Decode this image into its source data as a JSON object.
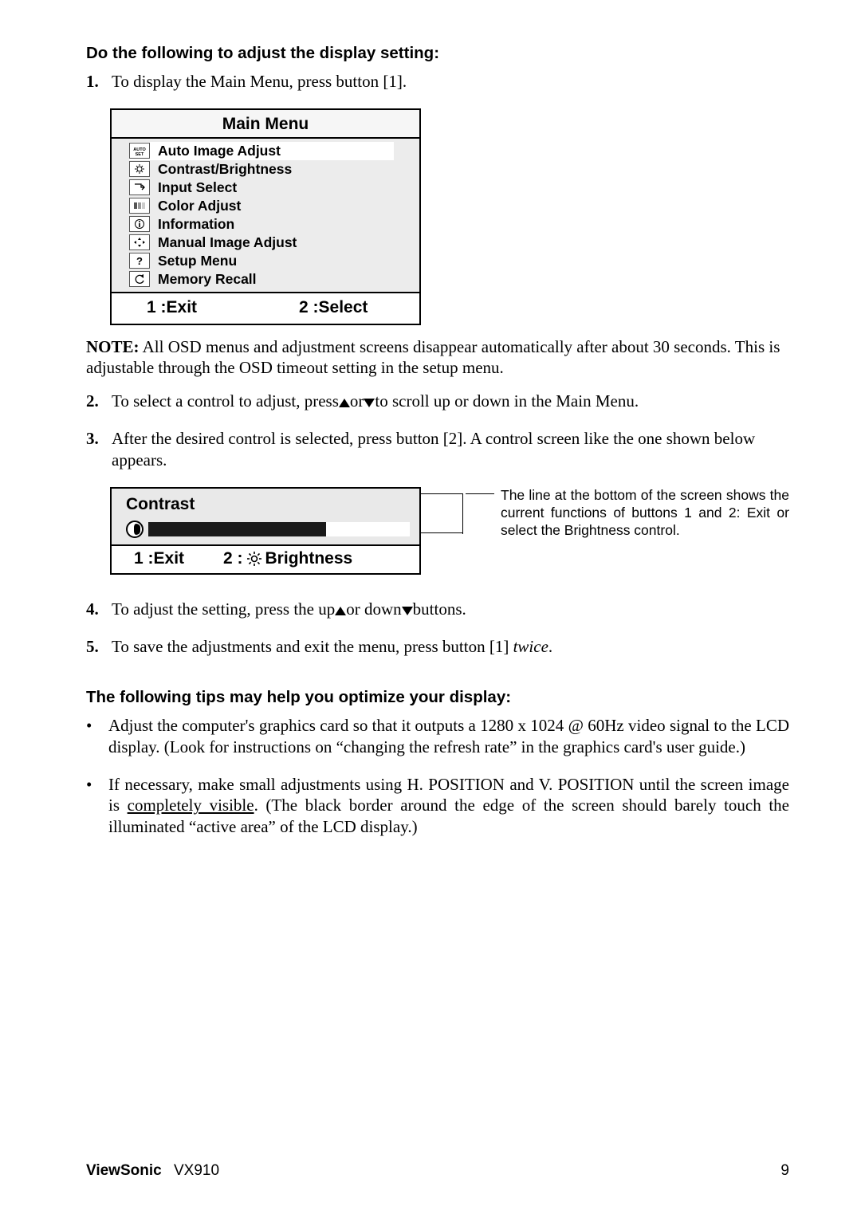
{
  "heading1": "Do the following to adjust the display setting:",
  "step1_num": "1.",
  "step1_text": "To display the Main Menu, press button [1].",
  "menu": {
    "title": "Main Menu",
    "items": [
      "Auto Image Adjust",
      "Contrast/Brightness",
      "Input Select",
      "Color Adjust",
      "Information",
      "Manual Image Adjust",
      "Setup Menu",
      "Memory Recall"
    ],
    "footer_left": "1 :Exit",
    "footer_right": "2 :Select"
  },
  "note_label": "NOTE:",
  "note_text": " All OSD menus and adjustment screens disappear automatically after about 30 seconds. This is adjustable through the OSD timeout setting in the setup menu.",
  "step2_num": "2.",
  "step2_a": "To select a control to adjust, press",
  "step2_b": "or",
  "step2_c": "to scroll up or down in the Main Menu.",
  "step3_num": "3.",
  "step3_text": "After the desired control is selected, press button [2]. A control screen like the one shown below appears.",
  "contrast": {
    "title": "Contrast",
    "left": "1 :Exit",
    "right_pre": "2 :",
    "right_post": " Brightness"
  },
  "callout": "The line at the bottom of the screen shows the current functions of buttons 1 and 2: Exit or select the Brightness control.",
  "step4_num": "4.",
  "step4_a": "To adjust the setting, press the up",
  "step4_b": "or down",
  "step4_c": "buttons.",
  "step5_num": "5.",
  "step5_a": "To save the adjustments and exit the menu, press button [1] ",
  "step5_b": "twice",
  "step5_c": ".",
  "heading2": "The following tips may help you optimize your display:",
  "tip1": "Adjust the computer's graphics card so that it outputs a 1280 x 1024 @ 60Hz video signal to the LCD display. (Look for instructions on “changing the refresh rate” in the graphics card's user guide.)",
  "tip2_a": "If necessary, make small adjustments using H. POSITION and V. POSITION until the screen image is ",
  "tip2_b": "completely visible",
  "tip2_c": ". (The black border around the edge of the screen should barely touch the illuminated “active area” of the LCD display.)",
  "footer": {
    "brand": "ViewSonic",
    "model": "VX910",
    "page": "9"
  }
}
